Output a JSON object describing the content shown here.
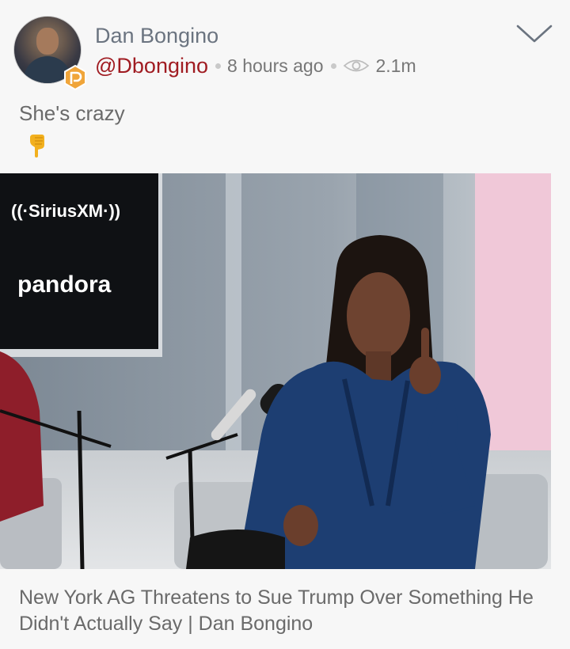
{
  "post": {
    "author_name": "Dan Bongino",
    "handle": "@Dbongino",
    "time": "8 hours ago",
    "views": "2.1m",
    "text": "She's crazy",
    "emoji": "👇",
    "image": {
      "logo_siriusxm": "((·SiriusXM·))",
      "logo_pandora": "pandora"
    },
    "link_title": "New York AG Threatens to Sue Trump Over Something He Didn't Actually Say | Dan Bongino"
  },
  "colors": {
    "handle": "#a01c22",
    "name": "#6b7480",
    "badge": "#f0a53a",
    "background": "#f7f7f7"
  },
  "icons": {
    "badge": "parler-badge-icon",
    "eye": "eye-icon",
    "menu": "chevron-down-icon",
    "emoji": "pointing-down-emoji"
  }
}
